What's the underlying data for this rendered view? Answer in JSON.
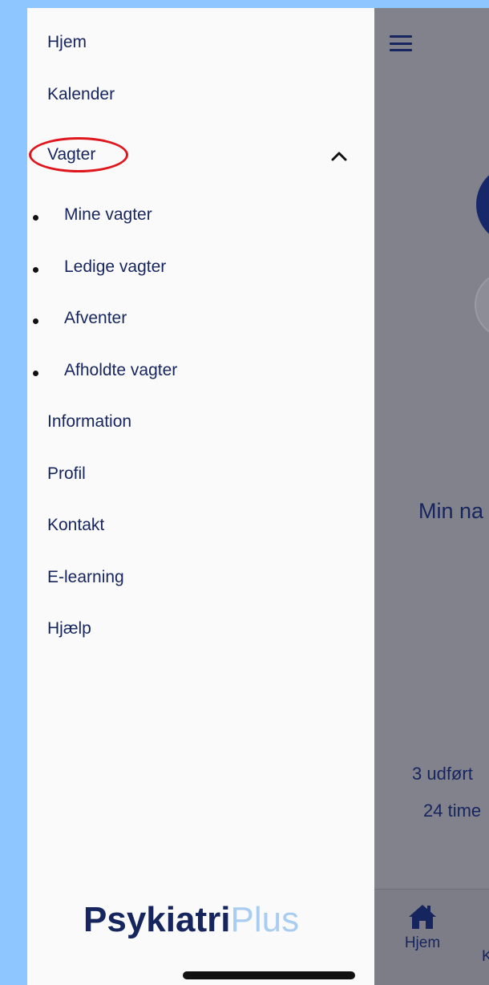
{
  "drawer": {
    "items": [
      {
        "label": "Hjem"
      },
      {
        "label": "Kalender"
      },
      {
        "label": "Vagter",
        "expanded": true
      }
    ],
    "sub_items": [
      {
        "label": "Mine vagter"
      },
      {
        "label": "Ledige vagter"
      },
      {
        "label": "Afventer"
      },
      {
        "label": "Afholdte vagter"
      }
    ],
    "items_after": [
      {
        "label": "Information"
      },
      {
        "label": "Profil"
      },
      {
        "label": "Kontakt"
      },
      {
        "label": "E-learning"
      },
      {
        "label": "Hjælp"
      }
    ],
    "logo": {
      "part1": "Psykiatri",
      "part2": "Plus"
    }
  },
  "background": {
    "heading": "Min na",
    "stat1": "3 udført",
    "stat2": "24 time",
    "bottom_nav": {
      "home_label": "Hjem",
      "next_label": "K"
    }
  },
  "colors": {
    "primary": "#16255e",
    "logo_light": "#a9cdf0",
    "annotation": "#e0161d",
    "outer_background": "#8ec7ff"
  }
}
